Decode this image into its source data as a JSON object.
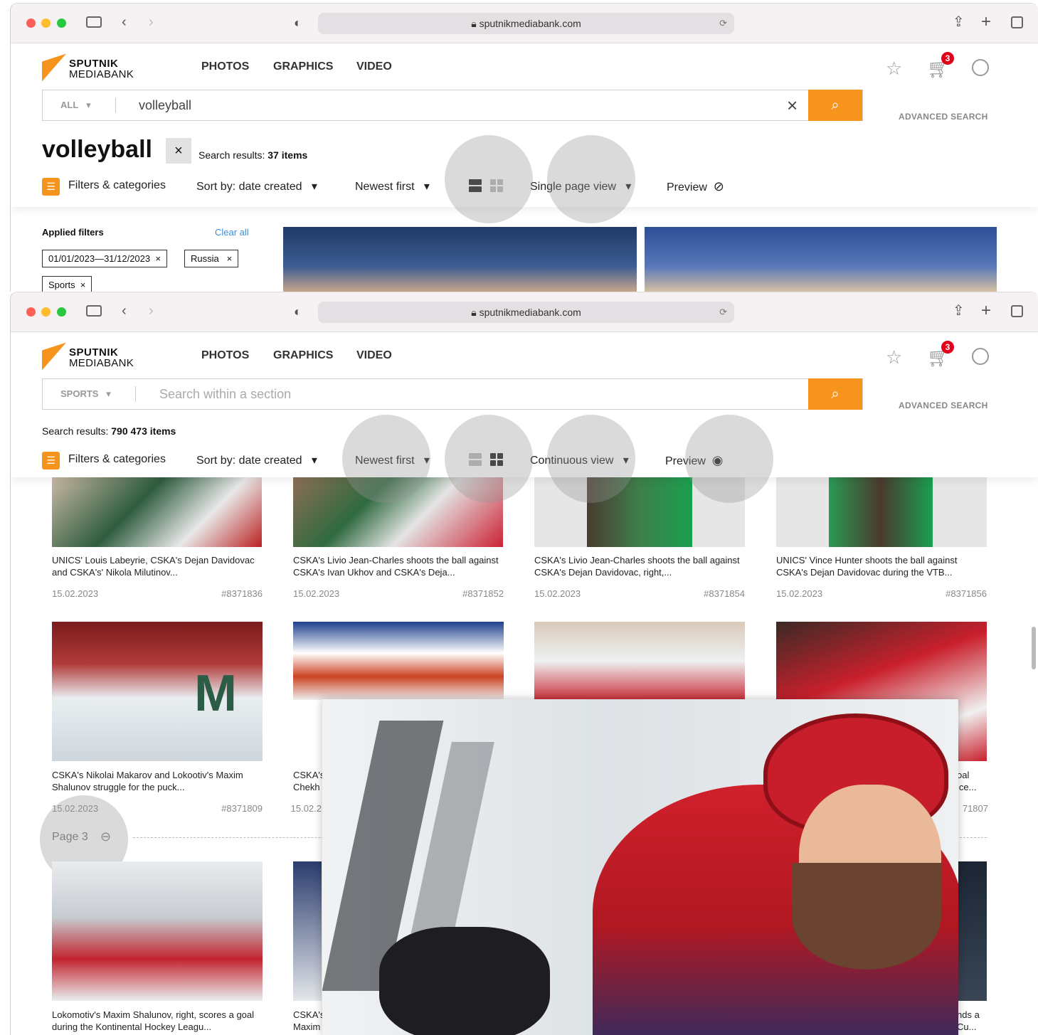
{
  "window1": {
    "url": "sputnikmediabank.com",
    "logo": {
      "line1": "SPUTNIK",
      "line2": "MEDIABANK"
    },
    "nav": [
      "PHOTOS",
      "GRAPHICS",
      "VIDEO"
    ],
    "cart_count": "3",
    "search": {
      "category": "ALL",
      "value": "volleyball",
      "clear": "×",
      "advanced": "ADVANCED SEARCH"
    },
    "heading": "volleyball",
    "results_label": "Search results: ",
    "results_count": "37 items",
    "toolbar": {
      "filters": "Filters & categories",
      "sort": "Sort by: date created",
      "order": "Newest first",
      "view": "Single page view",
      "preview": "Preview"
    },
    "filters": {
      "title": "Applied filters",
      "clear": "Clear all",
      "chips": [
        "01/01/2023—31/12/2023",
        "Russia",
        "Sports"
      ]
    }
  },
  "window2": {
    "url": "sputnikmediabank.com",
    "logo": {
      "line1": "SPUTNIK",
      "line2": "MEDIABANK"
    },
    "nav": [
      "PHOTOS",
      "GRAPHICS",
      "VIDEO"
    ],
    "cart_count": "3",
    "search": {
      "category": "SPORTS",
      "placeholder": "Search within a section",
      "advanced": "ADVANCED SEARCH"
    },
    "results_label": "Search results: ",
    "results_count": "790 473 items",
    "toolbar": {
      "filters": "Filters & categories",
      "sort": "Sort by: date created",
      "order": "Newest first",
      "view": "Continuous view",
      "preview": "Preview"
    },
    "row1": [
      {
        "caption": "UNICS' Louis Labeyrie, CSKA's Dejan Davidovac and CSKA's' Nikola Milutinov...",
        "date": "15.02.2023",
        "id": "#8371836"
      },
      {
        "caption": "CSKA's Livio Jean-Charles shoots the ball against CSKA's Ivan Ukhov and CSKA's Deja...",
        "date": "15.02.2023",
        "id": "#8371852"
      },
      {
        "caption": "CSKA's Livio Jean-Charles shoots the ball against CSKA's Dejan Davidovac, right,...",
        "date": "15.02.2023",
        "id": "#8371854"
      },
      {
        "caption": "UNICS' Vince Hunter shoots the ball against CSKA's Dejan Davidovac during the VTB...",
        "date": "15.02.2023",
        "id": "#8371856"
      }
    ],
    "row2": [
      {
        "caption": "CSKA's Nikolai Makarov and Lokootiv's Maxim Shalunov struggle for the puck...",
        "date": "15.02.2023",
        "id": "#8371809"
      },
      {
        "caption": "CSKA's Chekh",
        "date": "15.02.2",
        "id": ""
      },
      {
        "caption": "",
        "date": "",
        "id": ""
      },
      {
        "caption": "oal ice...",
        "date": "",
        "id": "71807"
      }
    ],
    "page_label": "Page 3",
    "row3": [
      {
        "caption": "Lokomotiv's Maxim Shalunov, right, scores a goal during the Kontinental Hockey Leagu..."
      },
      {
        "caption": "CSKA's Maxim"
      },
      {
        "caption": "nds a Cu..."
      }
    ]
  }
}
